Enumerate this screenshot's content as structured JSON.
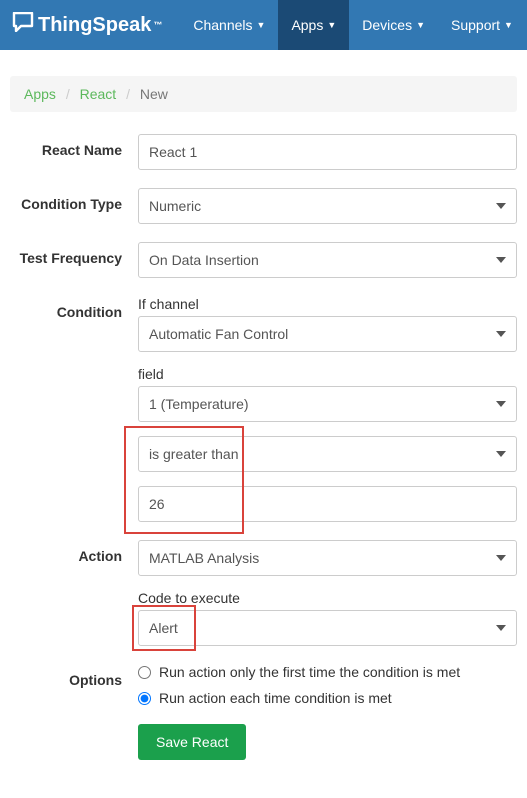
{
  "brand": "ThingSpeak",
  "nav": {
    "channels": "Channels",
    "apps": "Apps",
    "devices": "Devices",
    "support": "Support"
  },
  "breadcrumb": {
    "apps": "Apps",
    "react": "React",
    "current": "New"
  },
  "labels": {
    "react_name": "React Name",
    "condition_type": "Condition Type",
    "test_frequency": "Test Frequency",
    "condition": "Condition",
    "if_channel": "If channel",
    "field": "field",
    "action": "Action",
    "code_to_execute": "Code to execute",
    "options": "Options"
  },
  "values": {
    "react_name": "React 1",
    "condition_type": "Numeric",
    "test_frequency": "On Data Insertion",
    "channel": "Automatic Fan Control",
    "field": "1 (Temperature)",
    "comparison": "is greater than",
    "threshold": "26",
    "action": "MATLAB Analysis",
    "code": "Alert"
  },
  "options": {
    "first_time": "Run action only the first time the condition is met",
    "each_time": "Run action each time condition is met"
  },
  "buttons": {
    "save": "Save React"
  }
}
